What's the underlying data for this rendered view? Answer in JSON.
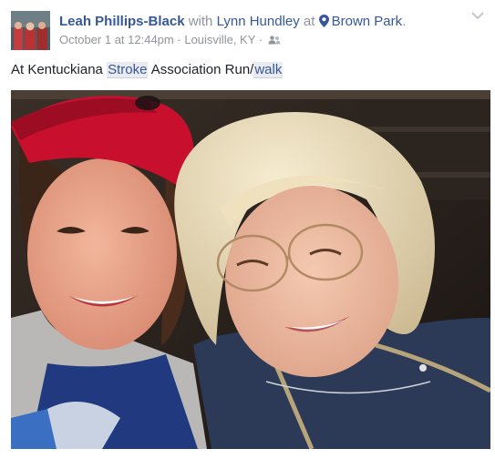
{
  "post": {
    "author_name": "Leah Phillips-Black",
    "with_text": "with",
    "tagged_name": "Lynn Hundley",
    "at_text": "at",
    "place_name": "Brown Park",
    "place_suffix": ".",
    "timestamp": "October 1 at 12:44pm",
    "separator": "·",
    "location": "Louisville, KY",
    "audience_icon": "friends-icon",
    "menu_icon": "chevron-down-icon"
  },
  "caption": {
    "part1": "At Kentuckiana ",
    "tag1": "Stroke",
    "part2": " Association Run/",
    "tag2": "walk"
  },
  "colors": {
    "link": "#365899",
    "muted": "#90949c",
    "text": "#1d2129",
    "tag_bg": "#e9ebee"
  }
}
